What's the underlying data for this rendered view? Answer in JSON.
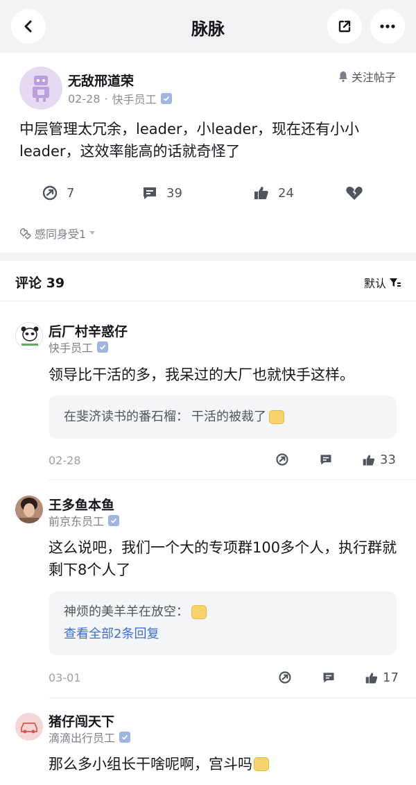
{
  "header": {
    "title": "脉脉"
  },
  "post": {
    "author": "无敌邢道荣",
    "date": "02-28",
    "separator": "·",
    "company_role": "快手员工",
    "follow_label": "关注帖子",
    "text": "中层管理太冗余，leader，小leader，现在还有小小leader，这效率能高的话就奇怪了",
    "forward_count": "7",
    "comment_count": "39",
    "like_count": "24",
    "reaction_label": "感同身受1"
  },
  "comments_section": {
    "title": "评论 39",
    "sort_label": "默认"
  },
  "comments": [
    {
      "name": "后厂村辛惑仔",
      "role": "快手员工",
      "text": "领导比干活的多，我呆过的大厂也就快手这样。",
      "reply_author": "在斐济读书的番石榴：",
      "reply_text": "干活的被裁了",
      "date": "02-28",
      "likes": "33"
    },
    {
      "name": "王多鱼本鱼",
      "role": "前京东员工",
      "text": "这么说吧，我们一个大的专项群100多个人，执行群就剩下8个人了",
      "reply_author": "神烦的美羊羊在放空：",
      "reply_link": "查看全部2条回复",
      "date": "03-01",
      "likes": "17"
    },
    {
      "name": "猪仔闯天下",
      "role": "滴滴出行员工",
      "text": "那么多小组长干啥呢啊，宫斗吗"
    }
  ],
  "colors": {
    "accent_link": "#3a6fd8",
    "background_gray": "#f2f3f5",
    "verify_badge": "#9fb6e3"
  }
}
